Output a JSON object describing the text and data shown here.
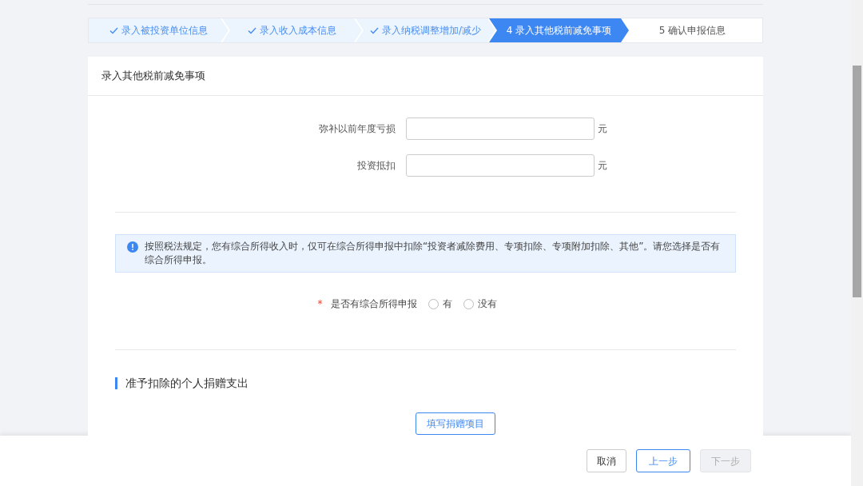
{
  "steps": [
    {
      "label": "录入被投资单位信息",
      "completed": true,
      "selected": false
    },
    {
      "label": "录入收入成本信息",
      "completed": true,
      "selected": false
    },
    {
      "label": "录入纳税调整增加/减少",
      "completed": true,
      "selected": false
    },
    {
      "number": "4",
      "label": "录入其他税前减免事项",
      "completed": false,
      "selected": true
    },
    {
      "number": "5",
      "label": "确认申报信息",
      "completed": false,
      "selected": false
    }
  ],
  "card": {
    "title": "录入其他税前减免事项",
    "fields": [
      {
        "label": "弥补以前年度亏损",
        "unit": "元"
      },
      {
        "label": "投资抵扣",
        "unit": "元"
      }
    ],
    "notice": "按照税法规定，您有综合所得收入时，仅可在综合所得申报中扣除“投资者减除费用、专项扣除、专项附加扣除、其他”。请您选择是否有综合所得申报。",
    "question": {
      "required_mark": "*",
      "label": "是否有综合所得申报",
      "options": [
        {
          "label": "有",
          "selected": false
        },
        {
          "label": "没有",
          "selected": false
        }
      ]
    },
    "section_title": "准予扣除的个人捐赠支出",
    "section_button": "填写捐赠项目"
  },
  "footer_buttons": [
    {
      "label": "取消",
      "kind": "default",
      "disabled": false
    },
    {
      "label": "上一步",
      "kind": "primary",
      "disabled": false
    },
    {
      "label": "下一步",
      "kind": "default",
      "disabled": true
    }
  ]
}
